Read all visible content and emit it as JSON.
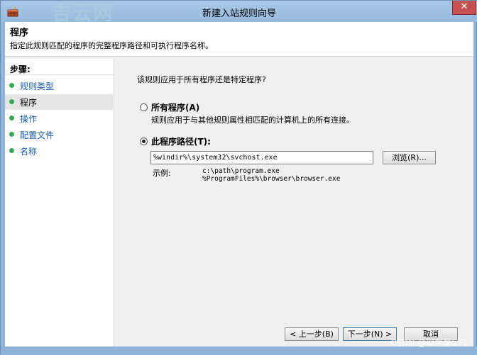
{
  "window": {
    "title": "新建入站规则向导",
    "watermark": "吉云网",
    "close_symbol": "✕"
  },
  "header": {
    "title": "程序",
    "description": "指定此规则匹配的程序的完整程序路径和可执行程序名称。"
  },
  "steps": {
    "title": "步骤:",
    "items": [
      {
        "label": "规则类型",
        "active": false
      },
      {
        "label": "程序",
        "active": true
      },
      {
        "label": "操作",
        "active": false
      },
      {
        "label": "配置文件",
        "active": false
      },
      {
        "label": "名称",
        "active": false
      }
    ]
  },
  "content": {
    "question": "该规则应用于所有程序还是特定程序?",
    "option_all": {
      "label": "所有程序(A)",
      "description": "规则应用于与其他规则属性相匹配的计算机上的所有连接。",
      "selected": false
    },
    "option_path": {
      "label": "此程序路径(T):",
      "selected": true
    },
    "path_value": "%windir%\\system32\\svchost.exe",
    "browse_label": "浏览(R)...",
    "example_label": "示例:",
    "example_lines": [
      "c:\\path\\program.exe",
      "%ProgramFiles%\\browser\\browser.exe"
    ]
  },
  "buttons": {
    "back": "< 上一步(B)",
    "next": "下一步(N) >",
    "cancel": "取消"
  },
  "watermark_csdn": "CSDN @现在是571",
  "colors": {
    "frame": "#8fb3d6",
    "step_dot": "#34a853",
    "link": "#1a5fb4",
    "close": "#c75050"
  }
}
